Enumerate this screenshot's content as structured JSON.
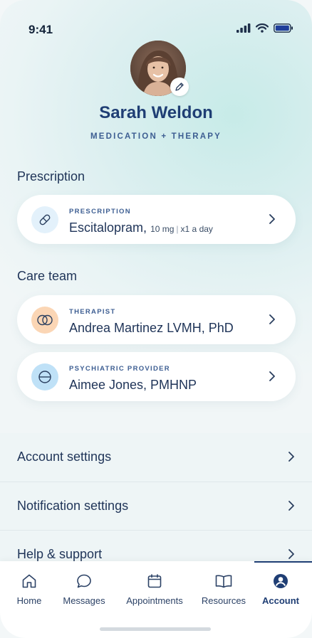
{
  "status_bar": {
    "time": "9:41",
    "icons": [
      "signal-icon",
      "wifi-icon",
      "battery-icon"
    ]
  },
  "profile": {
    "name": "Sarah Weldon",
    "plan": "MEDICATION + THERAPY",
    "avatar": "avatar-photo",
    "edit_icon": "pencil-icon"
  },
  "prescription_section": {
    "title": "Prescription",
    "card": {
      "kicker": "PRESCRIPTION",
      "medication": "Escitalopram,",
      "dose": "10 mg",
      "separator": "|",
      "frequency": "x1 a day",
      "icon": "pill-icon"
    }
  },
  "care_team_section": {
    "title": "Care team",
    "members": [
      {
        "kicker": "THERAPIST",
        "name": "Andrea Martinez LVMH, PhD",
        "icon": "therapy-rings-icon",
        "icon_bg": "#fbd6b5"
      },
      {
        "kicker": "PSYCHIATRIC PROVIDER",
        "name": "Aimee Jones, PMHNP",
        "icon": "pill-half-icon",
        "icon_bg": "#bfe1f7"
      }
    ]
  },
  "settings": [
    {
      "label": "Account settings"
    },
    {
      "label": "Notification settings"
    },
    {
      "label": "Help & support"
    }
  ],
  "tab_bar": {
    "tabs": [
      {
        "label": "Home",
        "icon": "home-icon"
      },
      {
        "label": "Messages",
        "icon": "chat-bubble-icon"
      },
      {
        "label": "Appointments",
        "icon": "calendar-icon"
      },
      {
        "label": "Resources",
        "icon": "book-icon"
      },
      {
        "label": "Account",
        "icon": "account-icon"
      }
    ],
    "active": "Account"
  },
  "colors": {
    "primary": "#1f3e74",
    "accent_text": "#3d5e92",
    "card_bg": "#ffffff",
    "therapist_icon_bg": "#fbd6b5",
    "provider_icon_bg": "#bfe1f7",
    "prescription_icon_bg": "#e3f1fb"
  }
}
